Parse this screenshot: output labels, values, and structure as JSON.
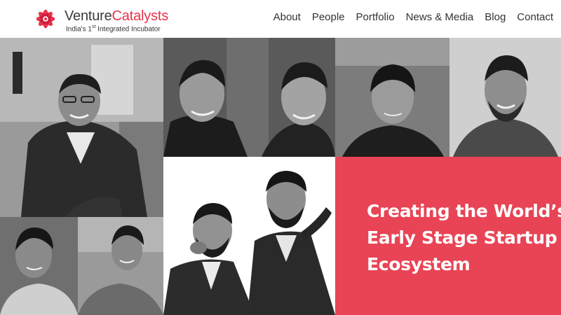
{
  "brand": {
    "name_part1": "Venture",
    "name_part2": "Catalysts",
    "tagline_prefix": "India's 1",
    "tagline_sup": "st",
    "tagline_suffix": " Integrated Incubator",
    "accent_color": "#e8334a",
    "logo_icon": "lotus-flower-icon"
  },
  "nav": {
    "items": [
      {
        "label": "About"
      },
      {
        "label": "People"
      },
      {
        "label": "Portfolio"
      },
      {
        "label": "News & Media"
      },
      {
        "label": "Blog"
      },
      {
        "label": "Contact"
      }
    ]
  },
  "hero": {
    "line1": "Creating the World’s L",
    "line2": "Early Stage Startup",
    "line3": "Ecosystem",
    "background_color": "#e84455"
  }
}
